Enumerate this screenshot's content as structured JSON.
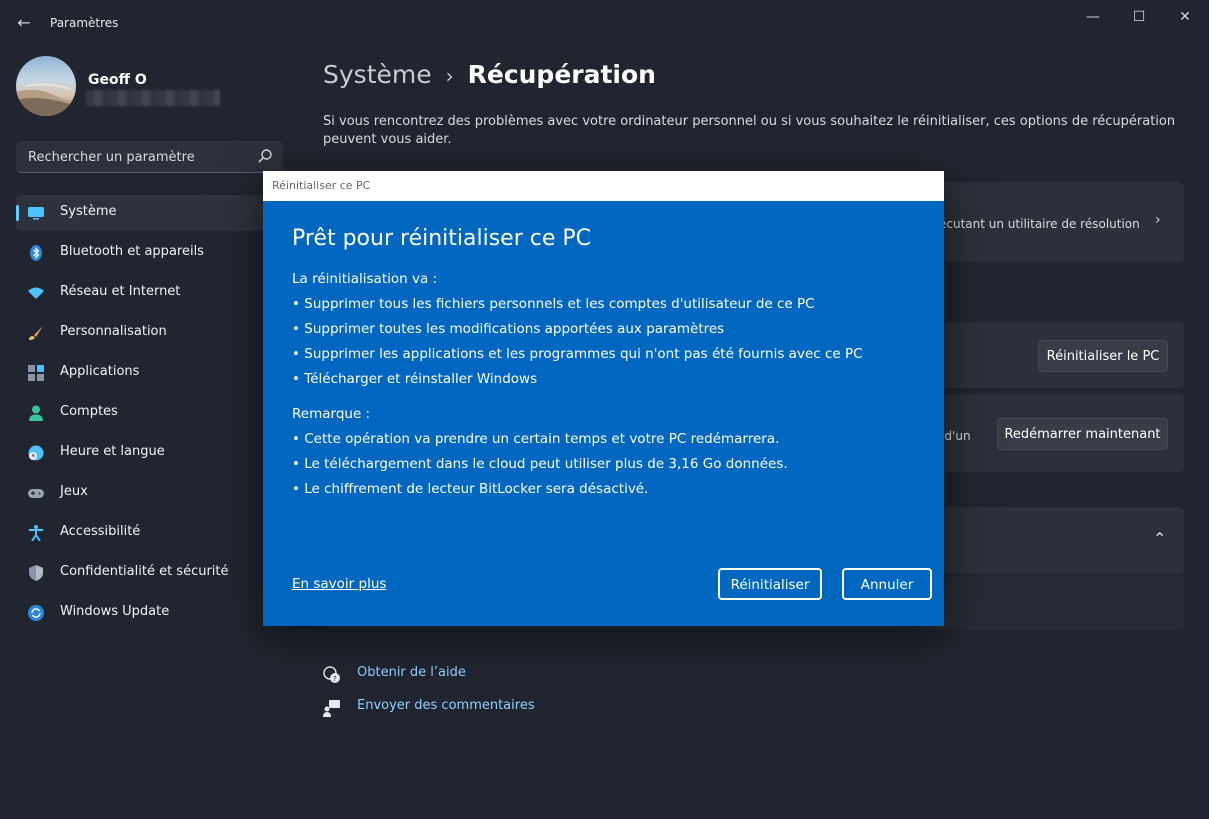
{
  "window": {
    "title": "Paramètres",
    "controls": {
      "minimize": "—",
      "maximize": "☐",
      "close": "✕"
    }
  },
  "profile": {
    "name": "Geoff O"
  },
  "search": {
    "placeholder": "Rechercher un paramètre"
  },
  "nav": {
    "items": [
      {
        "label": "Système",
        "icon": "monitor-icon",
        "active": true
      },
      {
        "label": "Bluetooth et appareils",
        "icon": "bluetooth-icon"
      },
      {
        "label": "Réseau et Internet",
        "icon": "wifi-icon"
      },
      {
        "label": "Personnalisation",
        "icon": "brush-icon"
      },
      {
        "label": "Applications",
        "icon": "apps-icon"
      },
      {
        "label": "Comptes",
        "icon": "person-icon"
      },
      {
        "label": "Heure et langue",
        "icon": "globe-clock-icon"
      },
      {
        "label": "Jeux",
        "icon": "gamepad-icon"
      },
      {
        "label": "Accessibilité",
        "icon": "accessibility-icon"
      },
      {
        "label": "Confidentialité et sécurité",
        "icon": "shield-icon"
      },
      {
        "label": "Windows Update",
        "icon": "update-icon"
      }
    ]
  },
  "main": {
    "breadcrumb": {
      "parent": "Système",
      "separator": "›",
      "current": "Récupération"
    },
    "intro": "Si vous rencontrez des problèmes avec votre ordinateur personnel ou si vous souhaitez le réinitialiser, ces options de récupération peuvent vous aider.",
    "card1_text": "écutant un utilitaire de résolution",
    "reset_button": "Réinitialiser le PC",
    "card3_text": "u d'un",
    "restart_button": "Redémarrer maintenant",
    "help": {
      "get_help": "Obtenir de l’aide",
      "feedback": "Envoyer des commentaires"
    }
  },
  "dialog": {
    "titlebar": "Réinitialiser ce PC",
    "heading": "Prêt pour réinitialiser ce PC",
    "intro": "La réinitialisation va :",
    "bullets": [
      "•  Supprimer tous les fichiers personnels et les comptes d'utilisateur de ce PC",
      "•  Supprimer toutes les modifications apportées aux paramètres",
      "•  Supprimer les applications et les programmes qui n'ont pas été fournis avec ce PC",
      "• Télécharger et réinstaller Windows"
    ],
    "note_title": "Remarque :",
    "notes": [
      "• Cette opération va prendre un certain temps et votre PC redémarrera.",
      "• Le téléchargement dans le cloud peut utiliser plus de 3,16 Go données.",
      "• Le chiffrement de lecteur BitLocker sera désactivé."
    ],
    "learn_more": "En savoir plus",
    "reset_button": "Réinitialiser",
    "cancel_button": "Annuler"
  },
  "colors": {
    "accent": "#60cdff",
    "dialog_bg": "#0067c0",
    "background": "#20252f",
    "card": "#2b303a",
    "link": "#8fd1ff"
  }
}
